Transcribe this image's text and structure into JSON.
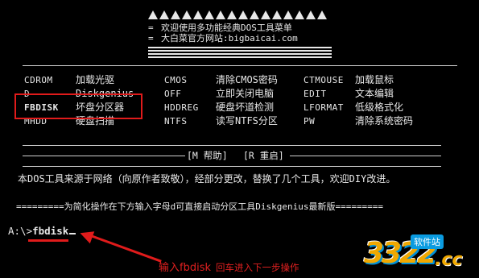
{
  "header": {
    "welcome_line": "欢迎使用多功能经典DOS工具菜单",
    "site_line": "大白菜官方网站:bigbaicai.com",
    "eq_mark": "="
  },
  "menu": {
    "col1": [
      {
        "cmd": "CDROM",
        "desc": "加载光驱"
      },
      {
        "cmd": "D",
        "desc": "Diskgenius"
      },
      {
        "cmd": "FBDISK",
        "desc": "坏盘分区器"
      },
      {
        "cmd": "MHDD",
        "desc": "硬盘扫描"
      }
    ],
    "col2": [
      {
        "cmd": "CMOS",
        "desc": "清除CMOS密码"
      },
      {
        "cmd": "OFF",
        "desc": "立即关闭电脑"
      },
      {
        "cmd": "HDDREG",
        "desc": "硬盘坏道检测"
      },
      {
        "cmd": "NTFS",
        "desc": "读写NTFS分区"
      }
    ],
    "col3": [
      {
        "cmd": "CTMOUSE",
        "desc": "加载鼠标"
      },
      {
        "cmd": "EDIT",
        "desc": "文本编辑"
      },
      {
        "cmd": "LFORMAT",
        "desc": "低级格式化"
      },
      {
        "cmd": "PW",
        "desc": "清除系统密码"
      }
    ]
  },
  "keys": {
    "help": "[M 帮助]",
    "restart": "[R 重启]"
  },
  "info_text": "本DOS工具来源于网络（向原作者致敬），经部分更改，替换了几个工具，欢迎DIY改进。",
  "note_text": "=========为简化操作在下方输入字母d可直接启动分区工具Diskgenius最新版=========",
  "prompt": {
    "path": "A:\\>",
    "input": "fbdisk"
  },
  "annotation": {
    "main": "输入fbdisk",
    "sub": "回车进入下一步操作",
    "color": "#e02020"
  },
  "watermark": {
    "digits": "3322",
    "site": "软件站",
    "tld": ".cc"
  },
  "colors": {
    "background": "#000000",
    "text": "#e8e8e8",
    "highlight": "#e01b1b"
  }
}
